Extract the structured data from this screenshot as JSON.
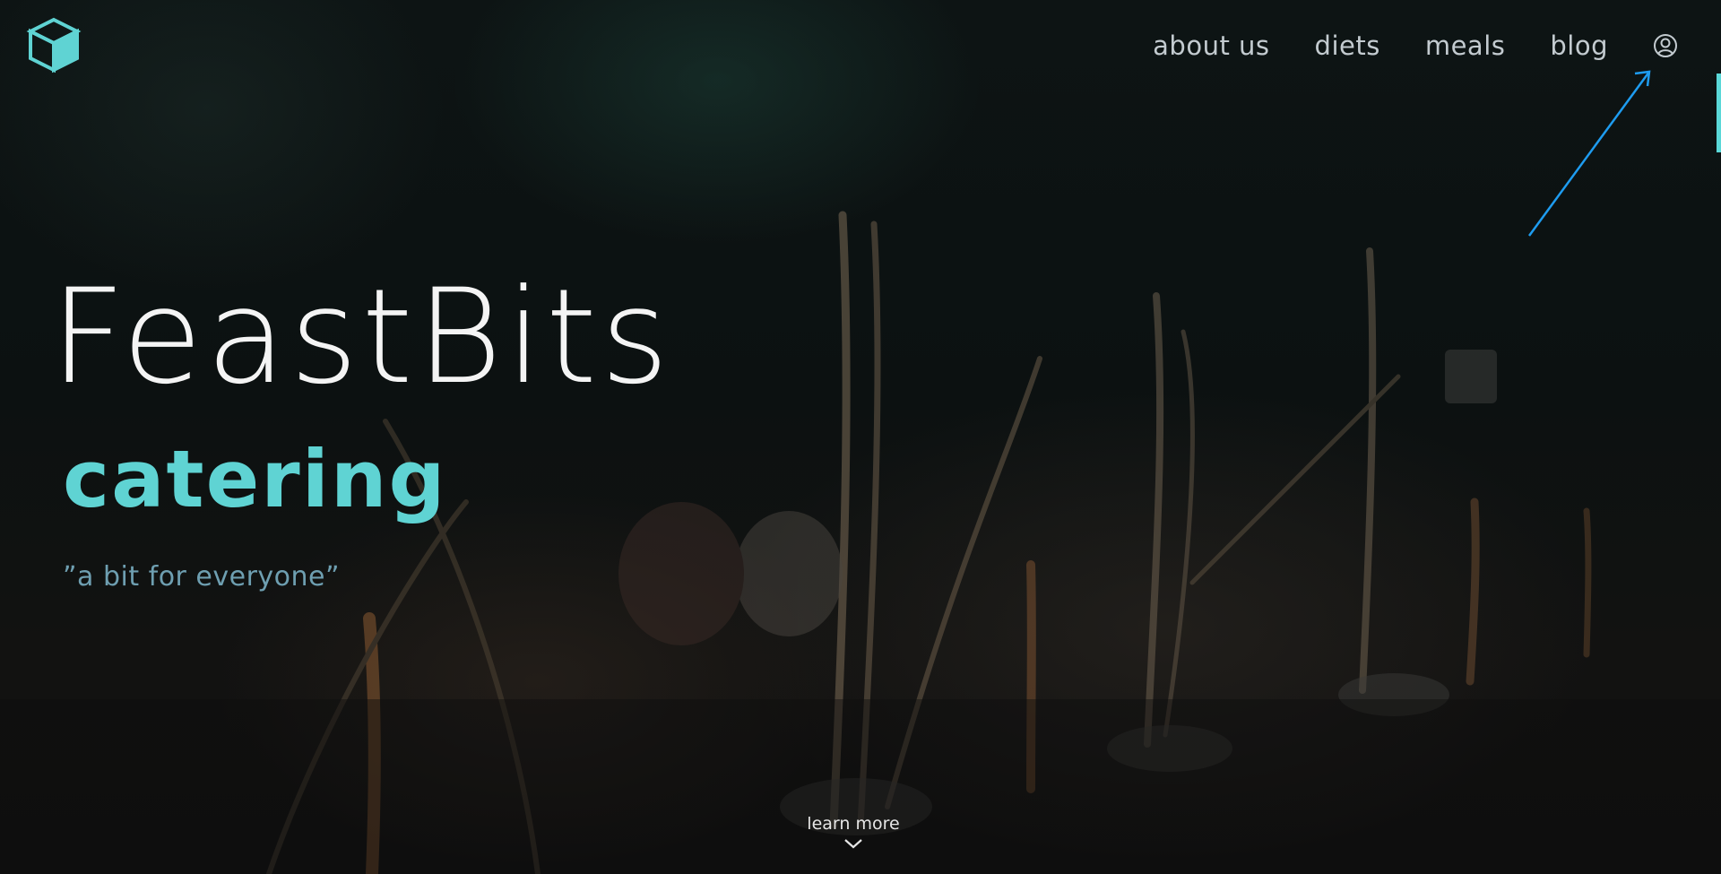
{
  "brand": {
    "logo_icon": "cube-icon",
    "accent_color": "#5fd3d3"
  },
  "nav": {
    "items": [
      {
        "label": "about us"
      },
      {
        "label": "diets"
      },
      {
        "label": "meals"
      },
      {
        "label": "blog"
      }
    ],
    "account_icon": "user-circle-icon"
  },
  "hero": {
    "title": "FeastBits",
    "subtitle": "catering",
    "tagline": "”a bit for everyone”"
  },
  "learn_more": {
    "label": "learn more",
    "icon": "chevron-down-icon"
  },
  "annotation": {
    "icon": "arrow-pointer-icon",
    "color": "#1e9cf0"
  }
}
